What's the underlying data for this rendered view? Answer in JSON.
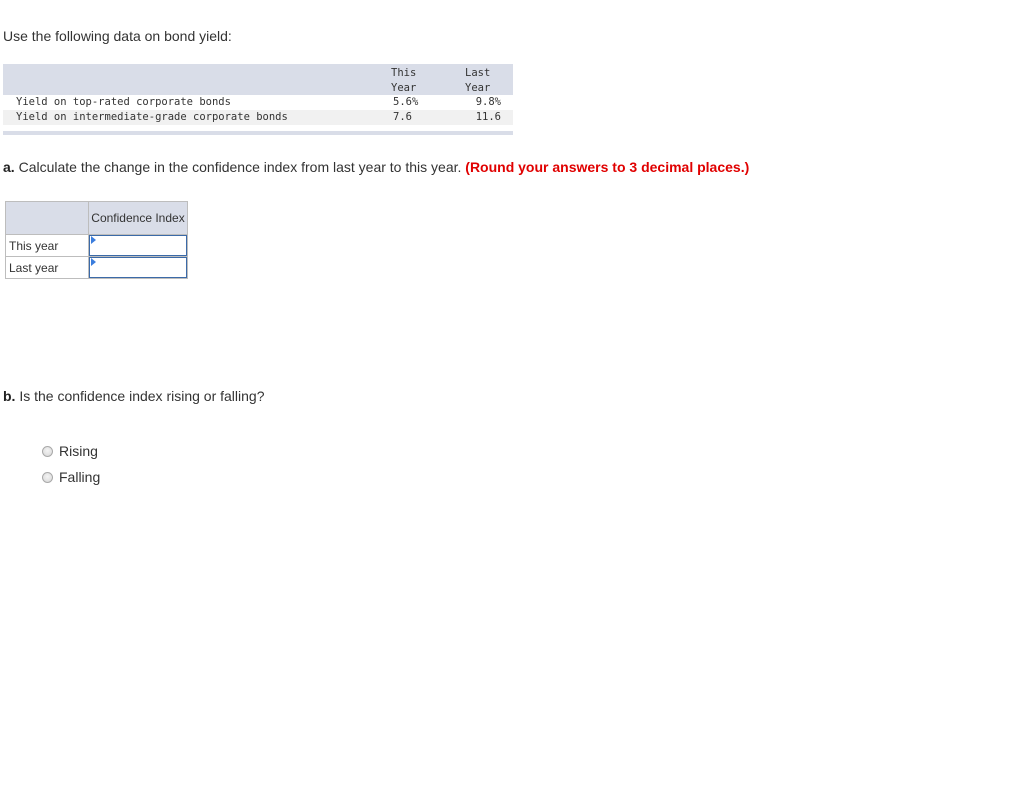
{
  "intro": "Use the following data on bond yield:",
  "bond_table": {
    "headers": {
      "this_year": "This\nYear",
      "last_year": "Last\nYear"
    },
    "rows": [
      {
        "label": "Yield on top-rated corporate bonds",
        "this_year": "5.6%",
        "last_year": "9.8%"
      },
      {
        "label": "Yield on intermediate-grade corporate bonds",
        "this_year": "7.6",
        "last_year": "11.6"
      }
    ]
  },
  "question_a": {
    "label": "a.",
    "text": " Calculate the change in the confidence index from last year to this year. ",
    "note": "(Round your answers to 3 decimal places.)"
  },
  "answer_table": {
    "column_header": "Confidence Index",
    "rows": [
      {
        "label": "This year",
        "value": ""
      },
      {
        "label": "Last year",
        "value": ""
      }
    ]
  },
  "question_b": {
    "label": "b.",
    "text": " Is the confidence index rising or falling?",
    "options": [
      "Rising",
      "Falling"
    ]
  }
}
